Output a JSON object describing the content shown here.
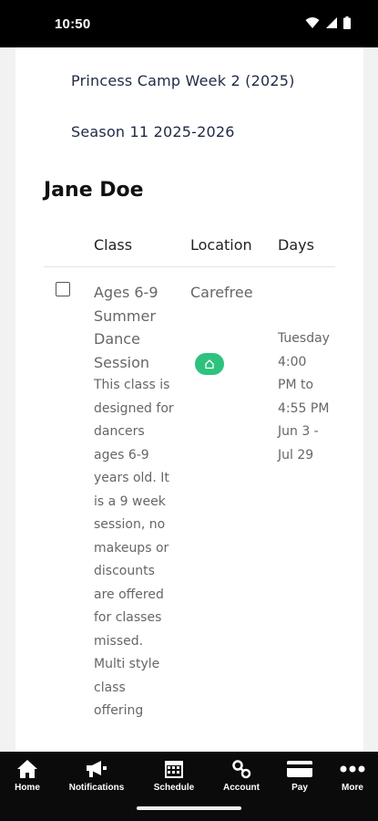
{
  "status_bar": {
    "time": "10:50"
  },
  "registration_list": {
    "items": [
      "Princess Camp Week 2 (2025)",
      "Season 11 2025-2026"
    ]
  },
  "student": {
    "name": "Jane Doe"
  },
  "table": {
    "headers": {
      "class": "Class",
      "location": "Location",
      "days": "Days"
    },
    "rows": [
      {
        "checked": false,
        "class_name": "Ages 6-9 Summer Dance Session",
        "description": "This class is designed for dancers ages 6-9 years old. It is a 9 week session, no makeups or discounts are offered for classes missed. Multi style class offering",
        "location": "Carefree",
        "location_icon": "home-icon",
        "days_lines": [
          "Tuesday",
          "4:00",
          "PM to",
          "4:55 PM",
          "Jun 3 -",
          "Jul 29"
        ]
      }
    ]
  },
  "bottom_nav": {
    "items": [
      {
        "label": "Home",
        "icon": "home-icon"
      },
      {
        "label": "Notifications",
        "icon": "megaphone-icon"
      },
      {
        "label": "Schedule",
        "icon": "calendar-icon"
      },
      {
        "label": "Account",
        "icon": "account-icon"
      },
      {
        "label": "Pay",
        "icon": "credit-card-icon"
      },
      {
        "label": "More",
        "icon": "more-icon"
      }
    ]
  },
  "colors": {
    "badge": "#2ec27e",
    "nav_background": "#0b0b0b",
    "status_background": "#000000"
  }
}
